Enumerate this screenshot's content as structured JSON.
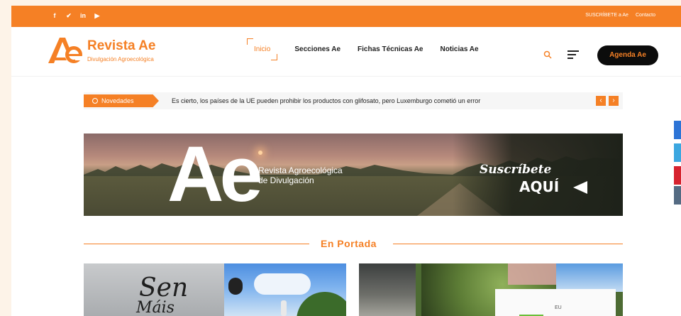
{
  "topbar": {
    "social": [
      {
        "icon": "facebook-icon",
        "glyph": "f"
      },
      {
        "icon": "twitter-icon",
        "glyph": "✔"
      },
      {
        "icon": "linkedin-icon",
        "glyph": "in"
      },
      {
        "icon": "youtube-icon",
        "glyph": "▶"
      }
    ],
    "subscribe_link": "SUSCRÍBETE a Ae",
    "contact_link": "Contacto"
  },
  "header": {
    "logo_title": "Revista Ae",
    "logo_subtitle": "Divulgación Agroecológica",
    "nav": [
      "Inicio",
      "Secciones Ae",
      "Fichas Técnicas Ae",
      "Noticias Ae"
    ],
    "agenda_label": "Agenda Ae"
  },
  "ticker": {
    "label": "Novedades",
    "text": "Es cierto, los países de la UE pueden prohibir los productos con glifosato, pero Luxemburgo cometió un error",
    "prev": "‹",
    "next": "›"
  },
  "banner": {
    "logo_text": "Ae",
    "subtitle_line1": "Revista Agroecológica",
    "subtitle_line2": "de Divulgación",
    "cta_line1": "Suscríbete",
    "cta_line2": "AQUÍ"
  },
  "section": {
    "title": "En Portada"
  },
  "cards": {
    "card1_line1": "Sen",
    "card1_line2": "Máis",
    "card2_label": "EU"
  },
  "colors": {
    "accent": "#f58025",
    "dark": "#0c0c0c"
  }
}
